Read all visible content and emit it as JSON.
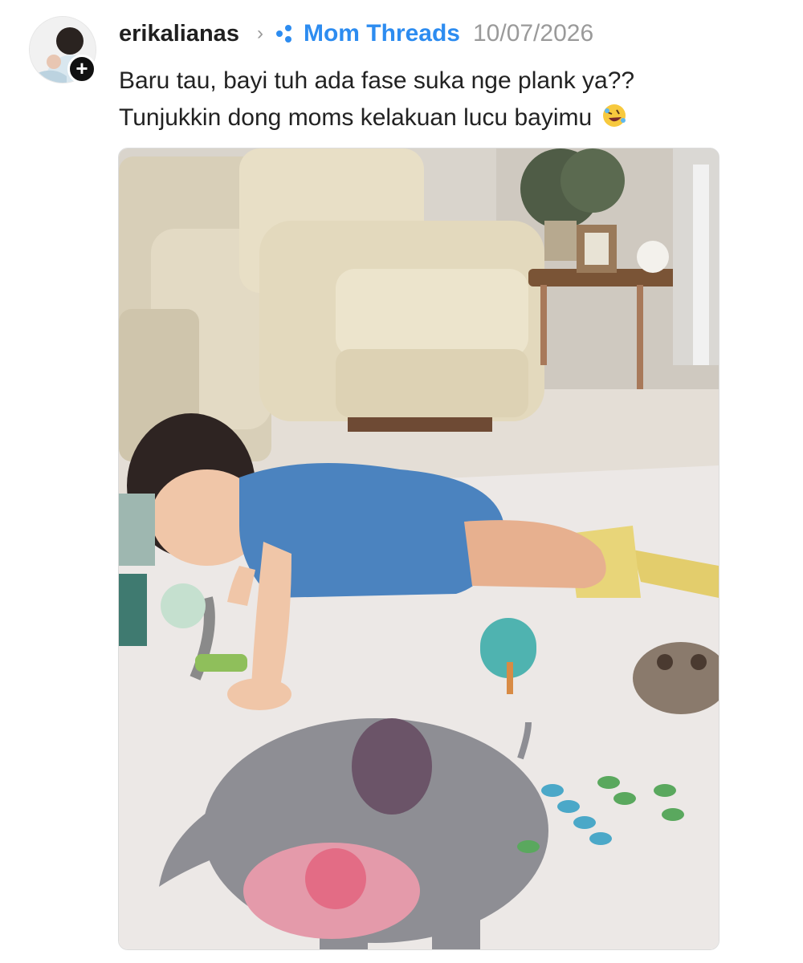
{
  "post": {
    "username": "erikalianas",
    "topic": "Mom Threads",
    "timestamp": "10/07/2026",
    "caption_line1": "Baru tau, bayi tuh ada fase suka nge plank ya??",
    "caption_line2": "Tunjukkin dong moms kelakuan lucu bayimu",
    "emoji": "rolling-on-floor-laughing-emoji",
    "follow_badge": "+"
  },
  "icons": {
    "chevron": "chevron-right-icon",
    "topic": "topic-tag-icon",
    "follow": "plus-follow-icon"
  },
  "colors": {
    "topic_blue": "#2d8cf0",
    "timestamp_gray": "#9a9a9a"
  }
}
